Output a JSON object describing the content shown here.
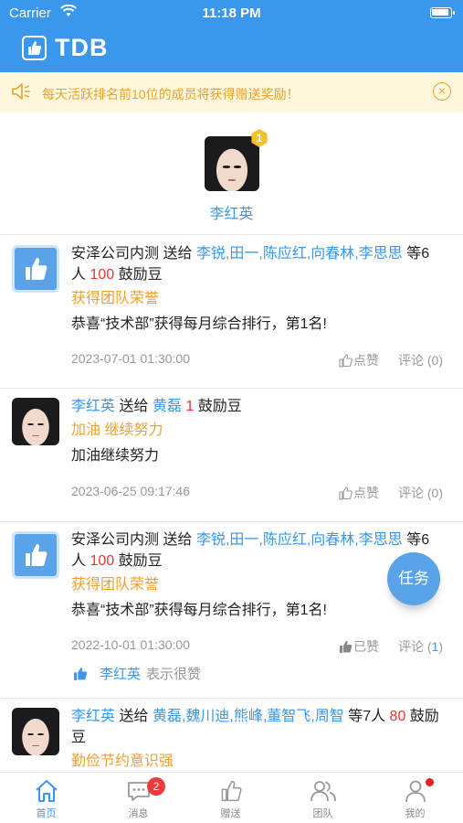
{
  "status": {
    "carrier": "Carrier",
    "time": "11:18 PM"
  },
  "header": {
    "title": "TDB"
  },
  "notice": {
    "text": "每天活跃排名前10位的成员将获得赠送奖励！",
    "close": "×"
  },
  "top_member": {
    "rank": "1",
    "name": "李红英"
  },
  "posts": [
    {
      "sender": "安泽公司内测",
      "verb": "送给",
      "recipients": "李锐,田一,陈应红,向春林,李思思",
      "count_text": "等6人",
      "amount": "100",
      "unit": "鼓励豆",
      "tag": "获得团队荣誉",
      "message": "恭喜“技术部”获得每月综合排行，第1名!",
      "date": "2023-07-01 01:30:00",
      "like_label": "点赞",
      "comment_label": "评论",
      "comment_count": "(0)"
    },
    {
      "sender": "李红英",
      "verb": "送给",
      "recipients": "黄磊",
      "amount": "1",
      "unit": "鼓励豆",
      "tag": "加油 继续努力",
      "message": "加油继续努力",
      "date": "2023-06-25 09:17:46",
      "like_label": "点赞",
      "comment_label": "评论",
      "comment_count": "(0)"
    },
    {
      "sender": "安泽公司内测",
      "verb": "送给",
      "recipients": "李锐,田一,陈应红,向春林,李思思",
      "count_text": "等6人",
      "amount": "100",
      "unit": "鼓励豆",
      "tag": "获得团队荣誉",
      "message": "恭喜“技术部”获得每月综合排行，第1名!",
      "date": "2022-10-01 01:30:00",
      "like_label": "已赞",
      "comment_label": "评论",
      "comment_count_open": "(",
      "comment_count_num": "1",
      "comment_count_close": ")",
      "liked_by": "李红英",
      "liked_suffix": "表示很赞"
    },
    {
      "sender": "李红英",
      "verb": "送给",
      "recipients": "黄磊,魏川迪,熊峰,董智飞,周智",
      "count_text": "等7人",
      "amount": "80",
      "unit": "鼓励豆",
      "tag": "勤俭节约意识强"
    }
  ],
  "fab": {
    "label": "任务"
  },
  "tabbar": {
    "tabs": [
      {
        "label": "首页",
        "icon": "home-icon",
        "active": true
      },
      {
        "label": "消息",
        "icon": "message-icon",
        "badge": "2"
      },
      {
        "label": "赠送",
        "icon": "thumbs-up-icon"
      },
      {
        "label": "团队",
        "icon": "team-icon"
      },
      {
        "label": "我的",
        "icon": "profile-icon",
        "dot": true
      }
    ]
  },
  "colors": {
    "primary": "#3a97ec",
    "accent_orange": "#f0a030",
    "amount_red": "#e33",
    "notice_bg": "#fdf7dc"
  }
}
